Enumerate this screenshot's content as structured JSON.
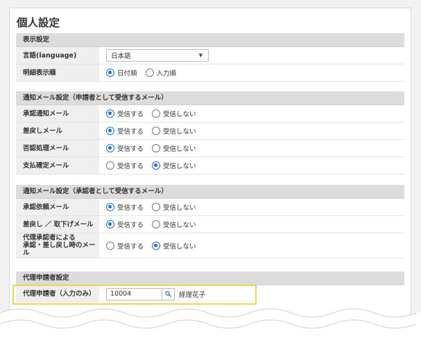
{
  "page_title": "個人設定",
  "display_settings": {
    "header": "表示設定",
    "language": {
      "label": "言語(language)",
      "selected": "日本語"
    },
    "detail_order": {
      "label": "明細表示順",
      "options": [
        {
          "label": "日付順",
          "checked": true
        },
        {
          "label": "入力順",
          "checked": false
        }
      ]
    }
  },
  "applicant_mail": {
    "header": "通知メール設定（申請者として受信するメール）",
    "rows": [
      {
        "label": "承認通知メール",
        "options": [
          {
            "label": "受信する",
            "checked": true
          },
          {
            "label": "受信しない",
            "checked": false
          }
        ]
      },
      {
        "label": "差戻しメール",
        "options": [
          {
            "label": "受信する",
            "checked": true
          },
          {
            "label": "受信しない",
            "checked": false
          }
        ]
      },
      {
        "label": "否認処理メール",
        "options": [
          {
            "label": "受信する",
            "checked": true
          },
          {
            "label": "受信しない",
            "checked": false
          }
        ]
      },
      {
        "label": "支払確定メール",
        "options": [
          {
            "label": "受信する",
            "checked": false
          },
          {
            "label": "受信しない",
            "checked": true
          }
        ]
      }
    ]
  },
  "approver_mail": {
    "header": "通知メール設定（承認者として受信するメール）",
    "rows": [
      {
        "label": "承認依頼メール",
        "options": [
          {
            "label": "受信する",
            "checked": true
          },
          {
            "label": "受信しない",
            "checked": false
          }
        ]
      },
      {
        "label": "差戻し ／ 取下げメール",
        "options": [
          {
            "label": "受信する",
            "checked": true
          },
          {
            "label": "受信しない",
            "checked": false
          }
        ]
      },
      {
        "label_line1": "代理承認者による",
        "label_line2": "承認・差し戻し時のメール",
        "options": [
          {
            "label": "受信する",
            "checked": false
          },
          {
            "label": "受信しない",
            "checked": true
          }
        ]
      }
    ]
  },
  "proxy": {
    "header": "代理申請者設定",
    "label": "代理申請者（入力のみ）",
    "code_value": "10004",
    "name": "経理花子"
  },
  "colors": {
    "accent": "#1e6fd9",
    "highlight": "#f2d24f",
    "section_header_bg": "#dcdcdc"
  },
  "icons": {
    "search": "search-icon",
    "dropdown": "chevron-down-icon"
  }
}
